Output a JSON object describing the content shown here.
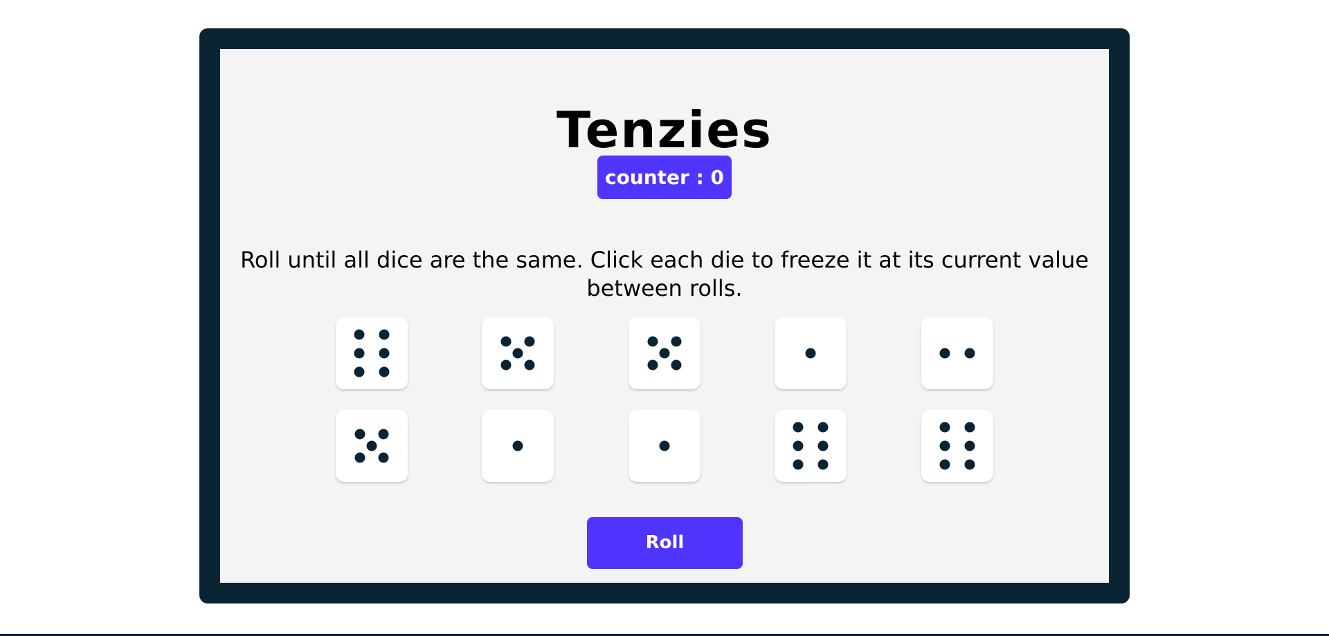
{
  "game": {
    "title": "Tenzies",
    "counter_label": "counter : 0",
    "instructions": "Roll until all dice are the same. Click each die to freeze it at its current value between rolls.",
    "roll_label": "Roll"
  },
  "dice": [
    {
      "value": 6,
      "held": false
    },
    {
      "value": 5,
      "held": false
    },
    {
      "value": 5,
      "held": false
    },
    {
      "value": 1,
      "held": false
    },
    {
      "value": 2,
      "held": false
    },
    {
      "value": 5,
      "held": false
    },
    {
      "value": 1,
      "held": false
    },
    {
      "value": 1,
      "held": false
    },
    {
      "value": 6,
      "held": false
    },
    {
      "value": 6,
      "held": false
    }
  ],
  "colors": {
    "frame": "#0b2434",
    "board": "#f4f4f4",
    "accent": "#5035ff",
    "pip": "#0b2434",
    "die_face": "#ffffff"
  }
}
